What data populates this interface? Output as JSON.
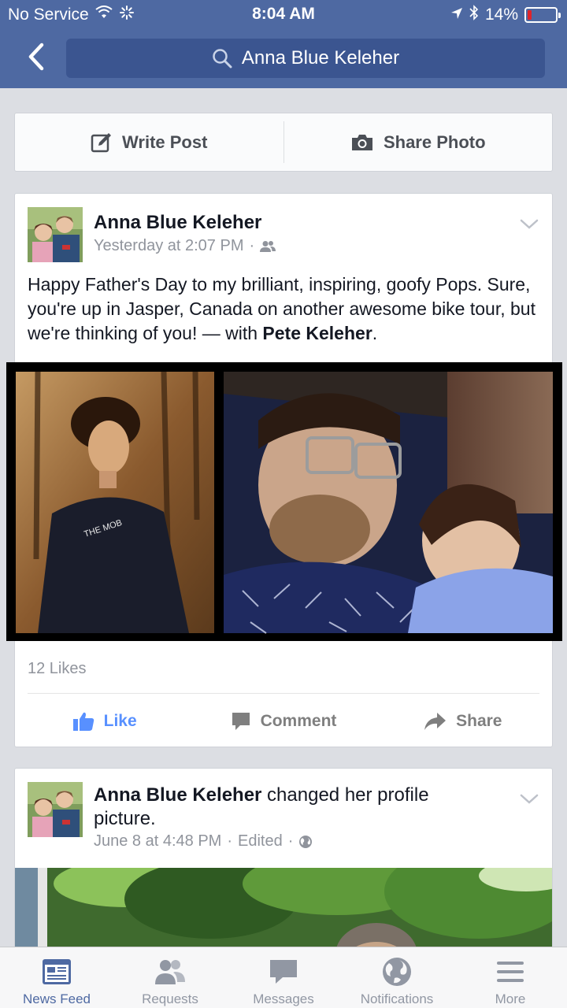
{
  "status_bar": {
    "carrier": "No Service",
    "time": "8:04 AM",
    "battery": "14%",
    "battery_level": 0.14
  },
  "header": {
    "search_text": "Anna Blue Keleher"
  },
  "composer": {
    "write_post": "Write Post",
    "share_photo": "Share Photo"
  },
  "posts": [
    {
      "author": "Anna Blue Keleher",
      "timestamp": "Yesterday at 2:07 PM",
      "separator": "·",
      "privacy_icon": "friends-icon",
      "text_main": "Happy Father's Day to my brilliant, inspiring, goofy Pops. Sure, you're up in Jasper, Canada on another awesome bike tour, but we're thinking of you! — with ",
      "tagged": "Pete Keleher",
      "text_end": ".",
      "likes": "12 Likes",
      "actions": {
        "like": "Like",
        "comment": "Comment",
        "share": "Share"
      }
    },
    {
      "author": "Anna Blue Keleher",
      "action_text": " changed her profile picture.",
      "timestamp": "June 8 at 4:48 PM",
      "separator": "·",
      "edited": "Edited",
      "separator2": "·",
      "privacy_icon": "globe-icon"
    }
  ],
  "tabbar": [
    {
      "label": "News Feed",
      "icon": "news-feed-icon",
      "active": true
    },
    {
      "label": "Requests",
      "icon": "requests-icon",
      "active": false
    },
    {
      "label": "Messages",
      "icon": "messages-icon",
      "active": false
    },
    {
      "label": "Notifications",
      "icon": "notifications-icon",
      "active": false
    },
    {
      "label": "More",
      "icon": "more-icon",
      "active": false
    }
  ],
  "colors": {
    "brand": "#4e69a2",
    "like_blue": "#5890ff",
    "battery_low": "#e0242a"
  }
}
